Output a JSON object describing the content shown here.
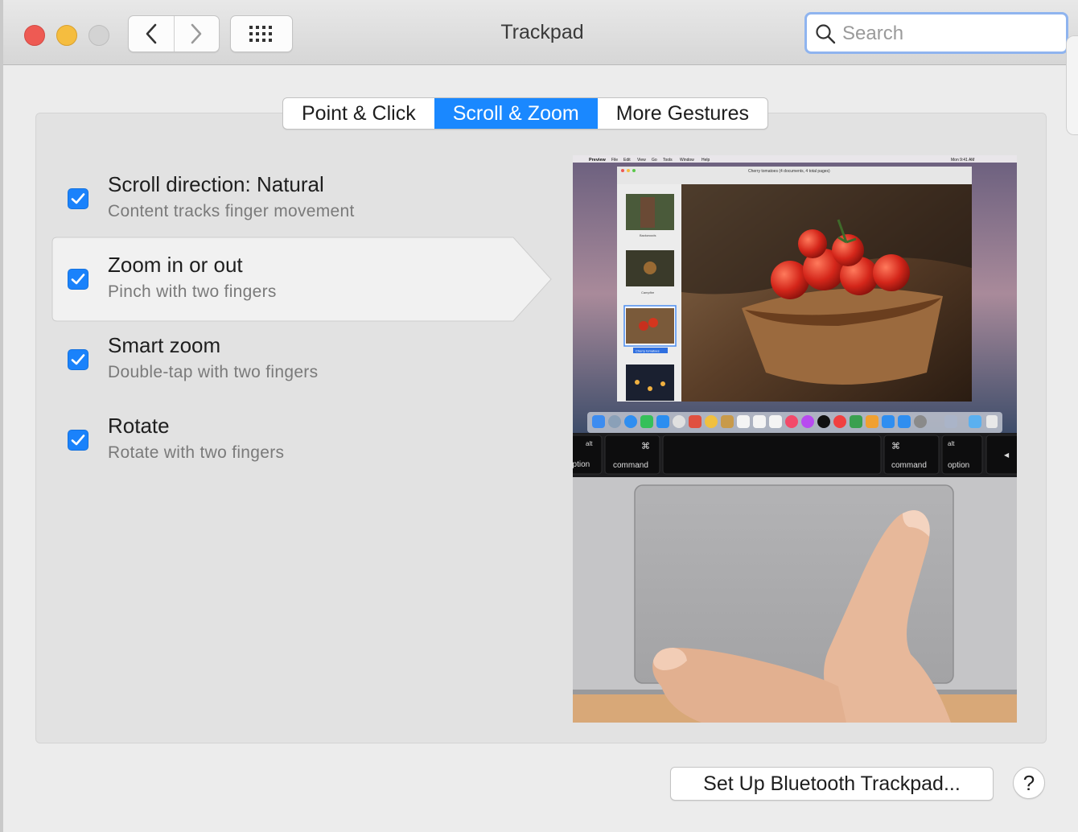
{
  "window": {
    "title": "Trackpad",
    "search_placeholder": "Search"
  },
  "tabs": [
    {
      "label": "Point & Click",
      "active": false
    },
    {
      "label": "Scroll & Zoom",
      "active": true
    },
    {
      "label": "More Gestures",
      "active": false
    }
  ],
  "options": [
    {
      "title": "Scroll direction: Natural",
      "subtitle": "Content tracks finger movement",
      "checked": true
    },
    {
      "title": "Zoom in or out",
      "subtitle": "Pinch with two fingers",
      "checked": true,
      "selected": true
    },
    {
      "title": "Smart zoom",
      "subtitle": "Double-tap with two fingers",
      "checked": true
    },
    {
      "title": "Rotate",
      "subtitle": "Rotate with two fingers",
      "checked": true
    }
  ],
  "preview": {
    "menubar_items": [
      "Preview",
      "File",
      "Edit",
      "View",
      "Go",
      "Tools",
      "Window",
      "Help"
    ],
    "menubar_clock": "Mon 9:41 AM",
    "doc_title": "Cherry tomatoes (4 documents, 4 total pages)",
    "thumbnails": [
      "Backwoods",
      "Campfire",
      "Cherry tomatoes",
      ""
    ],
    "keys": {
      "left_alt": "alt",
      "left_option": "option",
      "left_cmd_symbol": "⌘",
      "left_cmd": "command",
      "right_cmd_symbol": "⌘",
      "right_cmd": "command",
      "right_alt": "alt",
      "right_option": "option",
      "arrow": "◀"
    }
  },
  "buttons": {
    "bluetooth": "Set Up Bluetooth Trackpad...",
    "help": "?"
  },
  "colors": {
    "accent": "#1a88ff",
    "close": "#ee5a53",
    "minimize": "#f5bd3f"
  }
}
